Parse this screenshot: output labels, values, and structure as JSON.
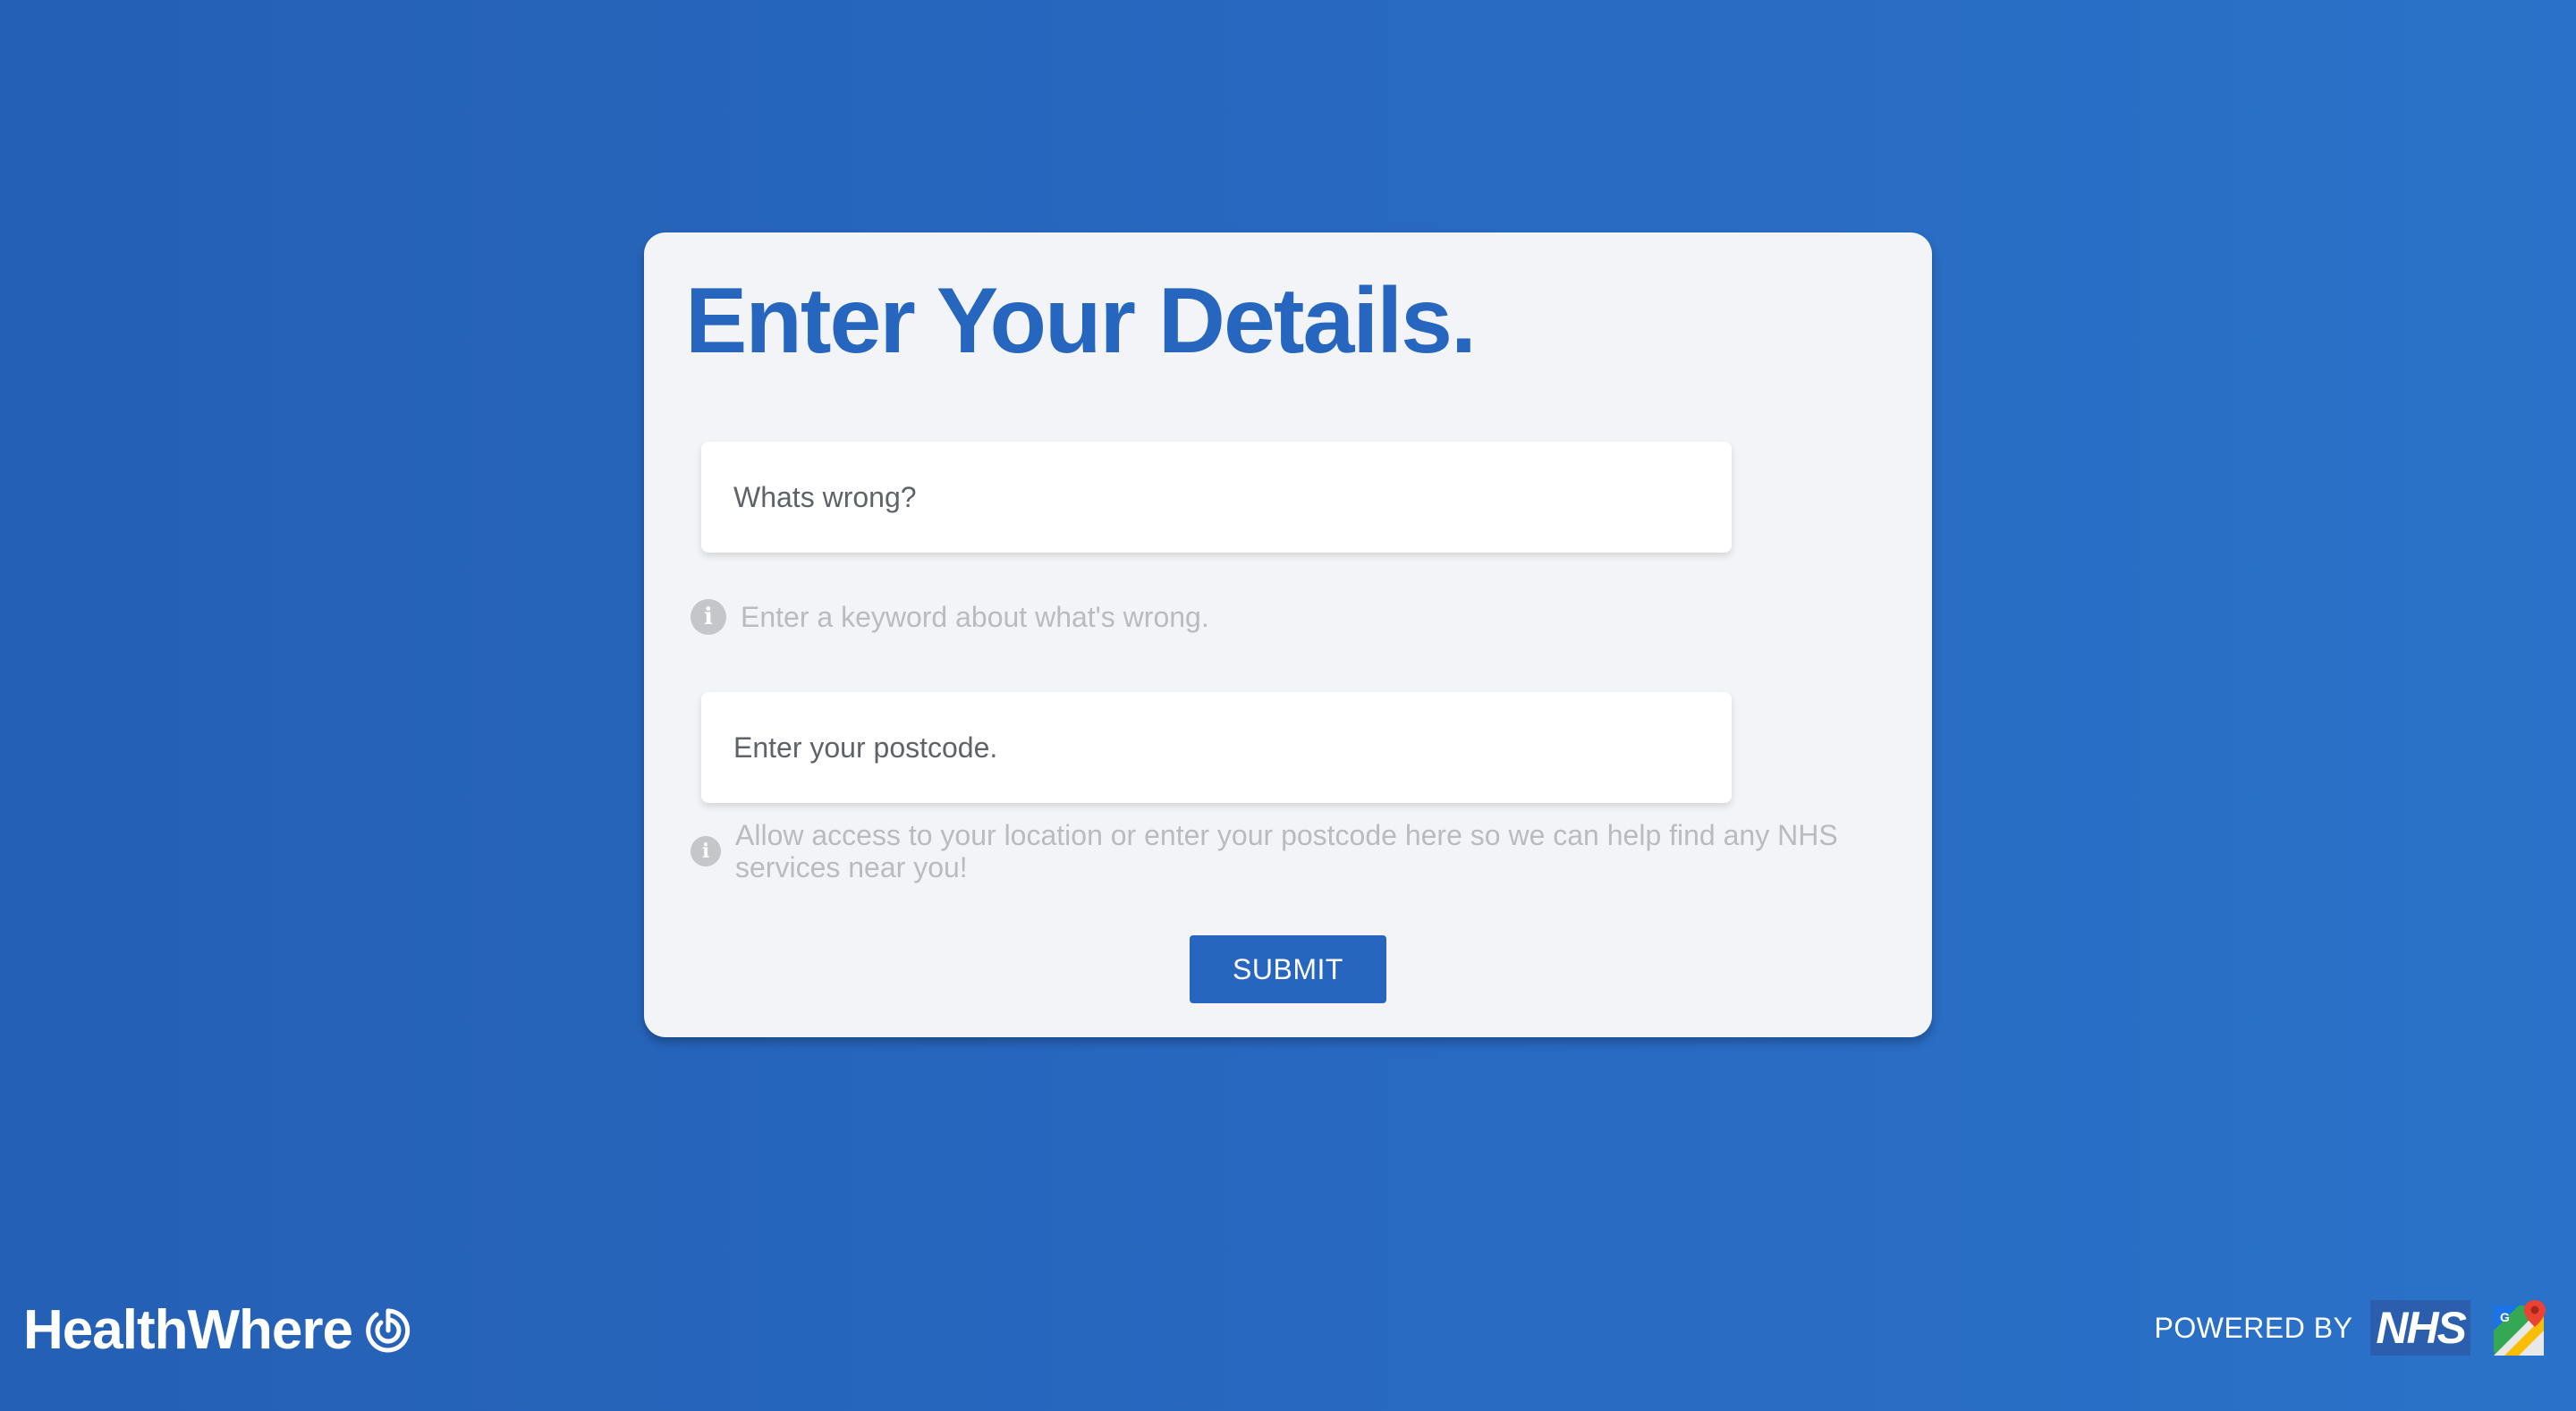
{
  "form": {
    "title": "Enter Your Details.",
    "problem_placeholder": "Whats wrong?",
    "problem_value": "",
    "problem_hint": "Enter a keyword about what's wrong.",
    "postcode_placeholder": "Enter your postcode.",
    "postcode_value": "",
    "postcode_hint": "Allow access to your location or enter your postcode here so we can help find any NHS services near you!",
    "submit_label": "SUBMIT",
    "info_icon_glyph": "i"
  },
  "footer": {
    "brand_name": "HealthWhere",
    "powered_by": "POWERED BY",
    "nhs_label": "NHS"
  },
  "icons": {
    "brand_logo": "target-icon",
    "hint_icon": "info-icon",
    "maps": "google-maps-icon"
  },
  "colors": {
    "background": "#2869c1",
    "accent": "#2666be",
    "card": "#f3f4f7",
    "hint_text": "#b9bbc0"
  }
}
